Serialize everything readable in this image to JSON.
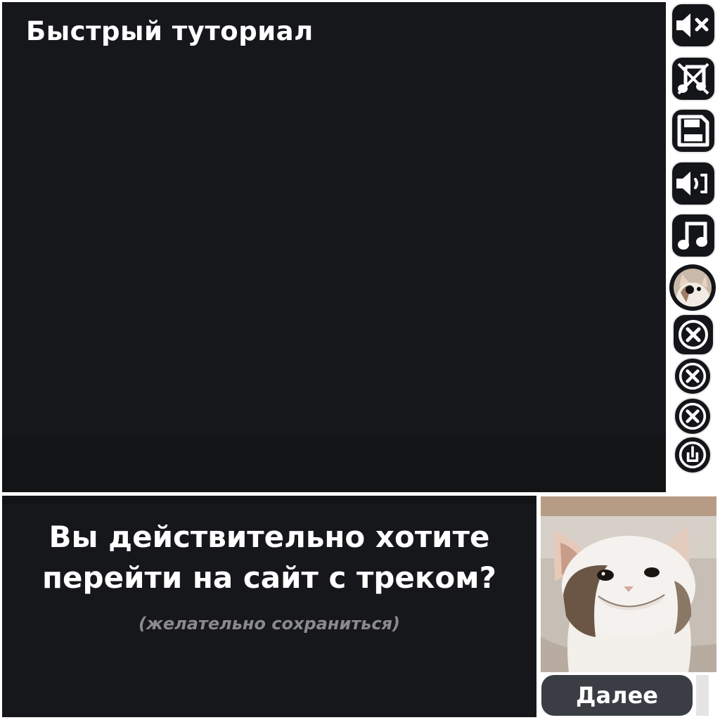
{
  "main": {
    "title": "Быстрый туториал"
  },
  "toolbar": {
    "buttons": [
      {
        "name": "mute-sound-icon"
      },
      {
        "name": "music-off-icon"
      },
      {
        "name": "save-icon"
      },
      {
        "name": "volume-icon"
      },
      {
        "name": "music-note-icon"
      },
      {
        "name": "cat-avatar"
      },
      {
        "name": "close-icon"
      },
      {
        "name": "close-icon"
      },
      {
        "name": "close-icon"
      },
      {
        "name": "power-icon"
      }
    ]
  },
  "dialog": {
    "question_line1": "Вы действительно хотите",
    "question_line2": "перейти на сайт с треком?",
    "hint": "(желательно сохраниться)",
    "next_label": "Далее"
  },
  "colors": {
    "panel": "#16171a",
    "button_border": "#e9e9e9",
    "next_button": "#3a3d44",
    "hint_text": "#8a8a8e"
  }
}
